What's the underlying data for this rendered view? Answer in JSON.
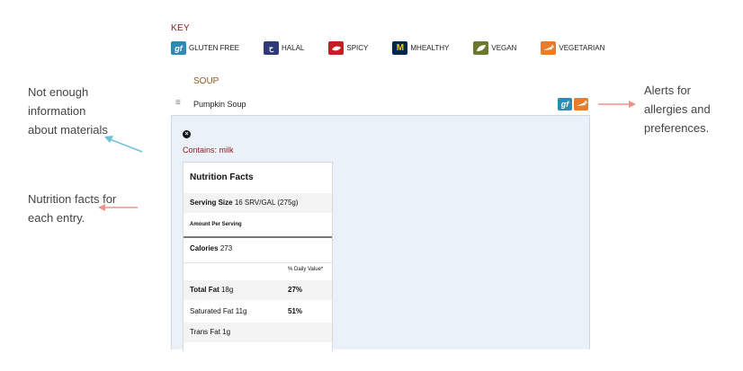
{
  "key": {
    "title": "KEY",
    "items": [
      {
        "icon": "gluten-free-icon",
        "glyph": "gf",
        "label": "GLUTEN FREE",
        "color": "#2f8bb3"
      },
      {
        "icon": "halal-icon",
        "glyph": "ح",
        "label": "HALAL",
        "color": "#2f3a7a"
      },
      {
        "icon": "spicy-icon",
        "glyph": "🌶",
        "label": "SPICY",
        "color": "#c91d24"
      },
      {
        "icon": "mhealthy-icon",
        "glyph": "M",
        "label": "MHEALTHY",
        "color": "#00274c"
      },
      {
        "icon": "vegan-icon",
        "glyph": "✿",
        "label": "VEGAN",
        "color": "#6b7a2a"
      },
      {
        "icon": "vegetarian-icon",
        "glyph": "🥕",
        "label": "VEGETARIAN",
        "color": "#e87c2b"
      }
    ]
  },
  "menu": {
    "category": "SOUP",
    "item": {
      "name": "Pumpkin Soup",
      "badges": [
        {
          "icon": "gluten-free-icon",
          "glyph": "gf"
        },
        {
          "icon": "vegetarian-icon",
          "glyph": "🥕"
        }
      ]
    },
    "detail": {
      "contains": "Contains: milk",
      "nutrition": {
        "title": "Nutrition Facts",
        "serving_label": "Serving Size",
        "serving_value": "16 SRV/GAL (275g)",
        "amount_per_serving": "Amount Per Serving",
        "calories_label": "Calories",
        "calories_value": "273",
        "daily_value_header": "% Daily Value*",
        "rows": [
          {
            "label": "Total Fat",
            "value": "18g",
            "pct": "27%"
          },
          {
            "label": "Saturated Fat",
            "value": "11g",
            "pct": "51%"
          },
          {
            "label": "Trans Fat",
            "value": "1g",
            "pct": ""
          }
        ]
      }
    }
  },
  "annotations": {
    "left_top": "Not enough information about materials",
    "left_bottom": "Nutrition facts for each entry.",
    "right": "Alerts for allergies and preferences."
  },
  "colors": {
    "accent_red": "#8a1c1c",
    "panel_bg": "#eaf1f9",
    "arrow_blue": "#6fc0d8",
    "arrow_salmon": "#f0928a"
  }
}
